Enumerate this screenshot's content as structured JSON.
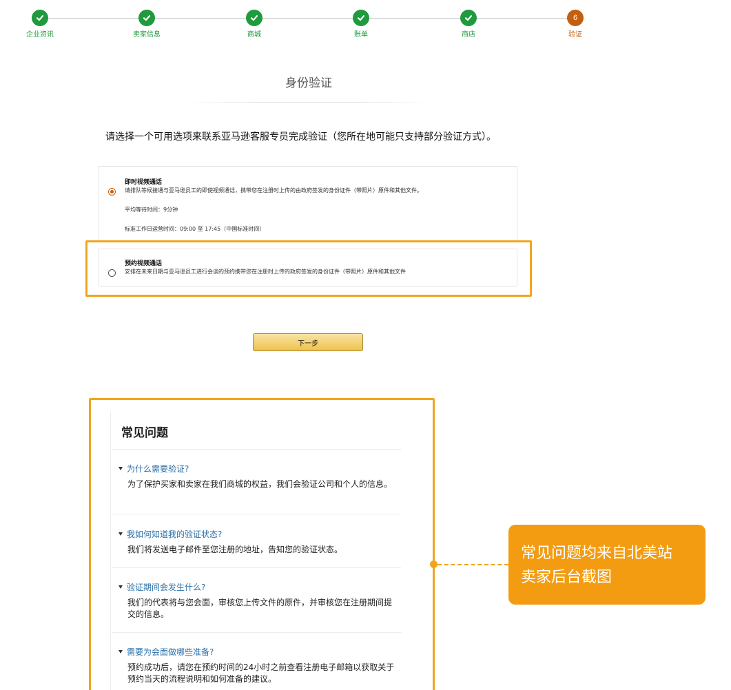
{
  "stepper": {
    "steps": [
      {
        "label": "企业资讯",
        "state": "done"
      },
      {
        "label": "卖家信息",
        "state": "done"
      },
      {
        "label": "商城",
        "state": "done"
      },
      {
        "label": "账单",
        "state": "done"
      },
      {
        "label": "商店",
        "state": "done"
      },
      {
        "label": "验证",
        "state": "current",
        "number": "6"
      }
    ],
    "colors": {
      "done": "#1f9a3c",
      "current": "#c45f0f"
    }
  },
  "page": {
    "title": "身份验证",
    "instruction": "请选择一个可用选项来联系亚马逊客服专员完成验证（您所在地可能只支持部分验证方式）。"
  },
  "options": [
    {
      "title": "即时视频通话",
      "desc": "请排队等候接通与亚马逊员工的即使视频通话，携带您在注册时上传的由政府签发的身份证件（带照片）原件和其他文件。",
      "wait": "平均等待时间：9分钟",
      "hours": "标准工作日运营时间：09:00 至 17:45（中国标准时间）",
      "selected": true
    },
    {
      "title": "预约视频通话",
      "desc": "安排在未来日期与亚马逊员工进行会谈的预约携带您在注册时上传的政府签发的身份证件（带照片）原件和其他文件",
      "selected": false
    }
  ],
  "next_button": {
    "label": "下一步"
  },
  "faq": {
    "heading": "常见问题",
    "items": [
      {
        "q": "为什么需要验证?",
        "a": "为了保护买家和卖家在我们商城的权益，我们会验证公司和个人的信息。"
      },
      {
        "q": "我如何知道我的验证状态?",
        "a": "我们将发送电子邮件至您注册的地址，告知您的验证状态。"
      },
      {
        "q": "验证期间会发生什么?",
        "a": "我们的代表将与您会面，审核您上传文件的原件，并审核您在注册期间提交的信息。"
      },
      {
        "q": "需要为会面做哪些准备?",
        "a": "预约成功后，请您在预约时间的24小时之前查看注册电子邮箱以获取关于预约当天的流程说明和如何准备的建议。"
      }
    ]
  },
  "callout": {
    "line1": "常见问题均来自北美站",
    "line2": "卖家后台截图",
    "color": "#f39c12"
  },
  "highlight_color": "#f0a51e"
}
